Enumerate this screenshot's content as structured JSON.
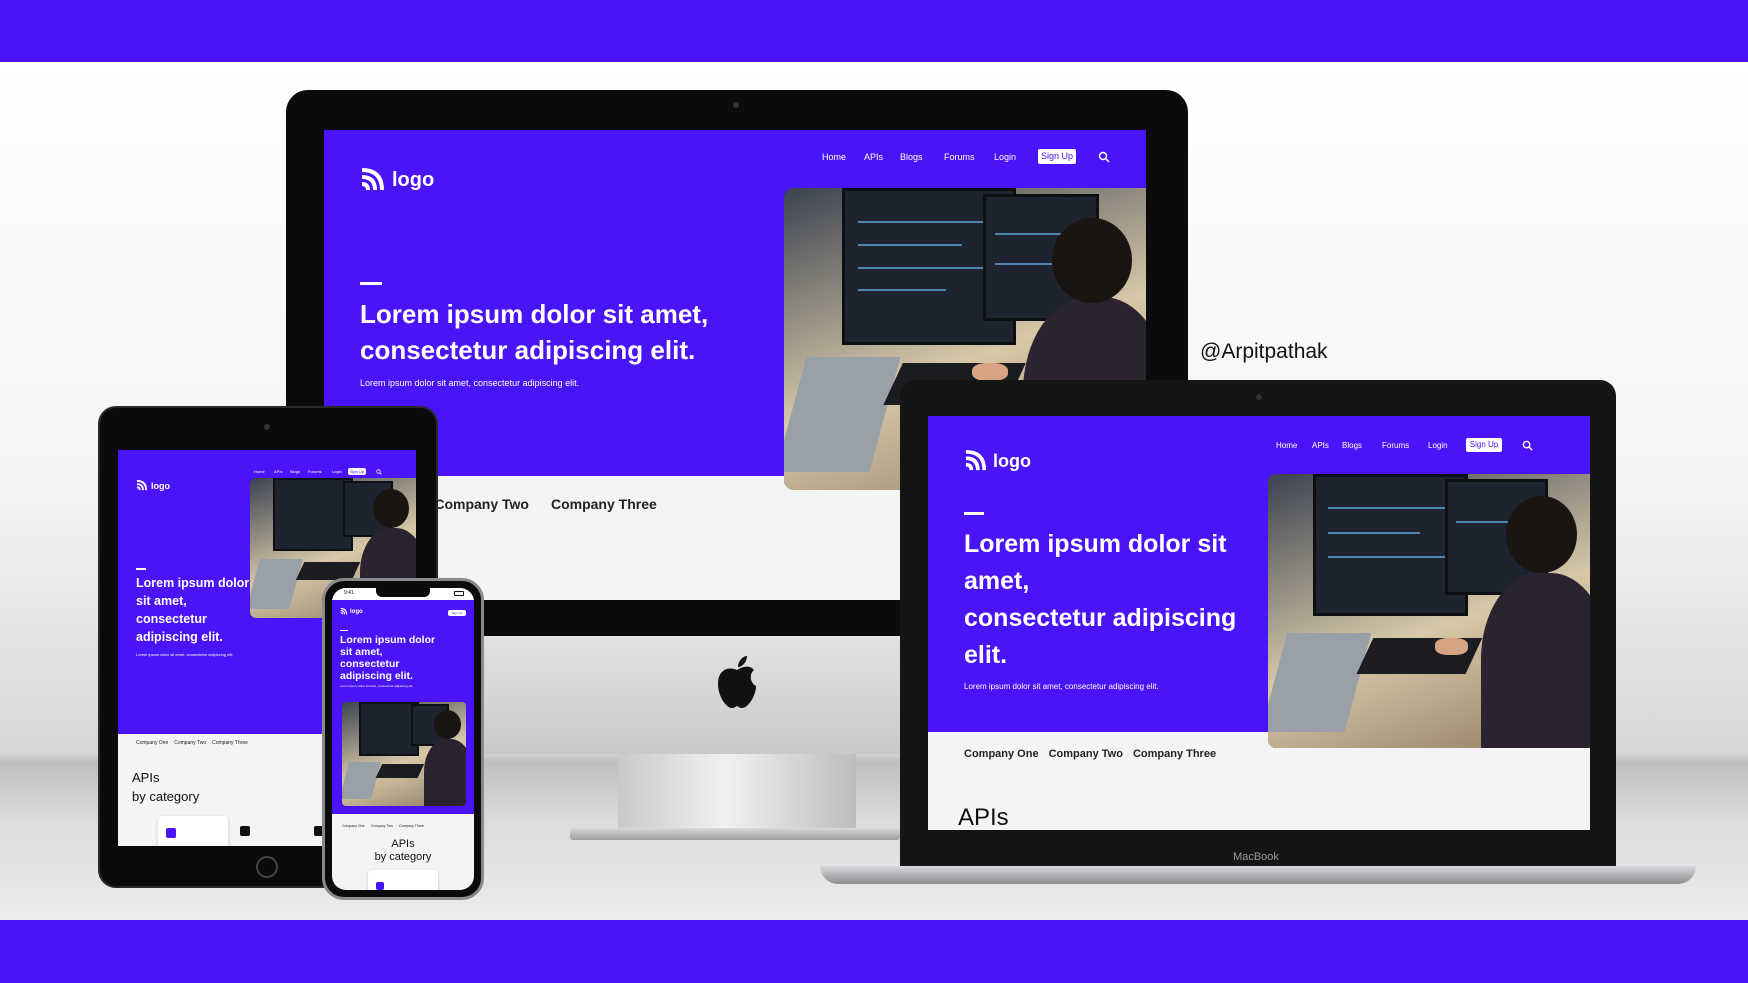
{
  "watermark": "@Arpitpathak",
  "site": {
    "logo_text": "logo",
    "nav": [
      "Home",
      "APIs",
      "Blogs",
      "Forums",
      "Login"
    ],
    "signup": "Sign Up",
    "headline_line1": "Lorem ipsum dolor sit amet,",
    "headline_line2": "consectetur adipiscing elit.",
    "subline": "Lorem ipsum dolor sit amet, consectetur adipiscing elit.",
    "companies": [
      "Company One",
      "Company Two",
      "Company Three"
    ],
    "apis_title": "APIs",
    "apis_subtitle": "by category"
  },
  "imac": {
    "company_partial": "ne",
    "companies_visible": [
      "Company Two",
      "Company Three"
    ]
  },
  "macbook": {
    "label": "MacBook",
    "headline_lines": [
      "Lorem ipsum dolor sit",
      "amet,",
      "consectetur adipiscing",
      "elit."
    ]
  },
  "ipad": {
    "headline_lines": [
      "Lorem ipsum dolor",
      "sit amet,",
      "consectetur",
      "adipiscing elit."
    ]
  },
  "iphone": {
    "status_time": "9:41",
    "headline_lines": [
      "Lorem ipsum dolor",
      "sit amet,",
      "consectetur",
      "adipiscing elit."
    ]
  },
  "colors": {
    "brand": "#4a14f8",
    "white": "#ffffff",
    "bezel": "#0b0b0b"
  },
  "icons": [
    "logo-mark-icon",
    "search-icon",
    "apple-logo-icon",
    "camera-icon"
  ]
}
